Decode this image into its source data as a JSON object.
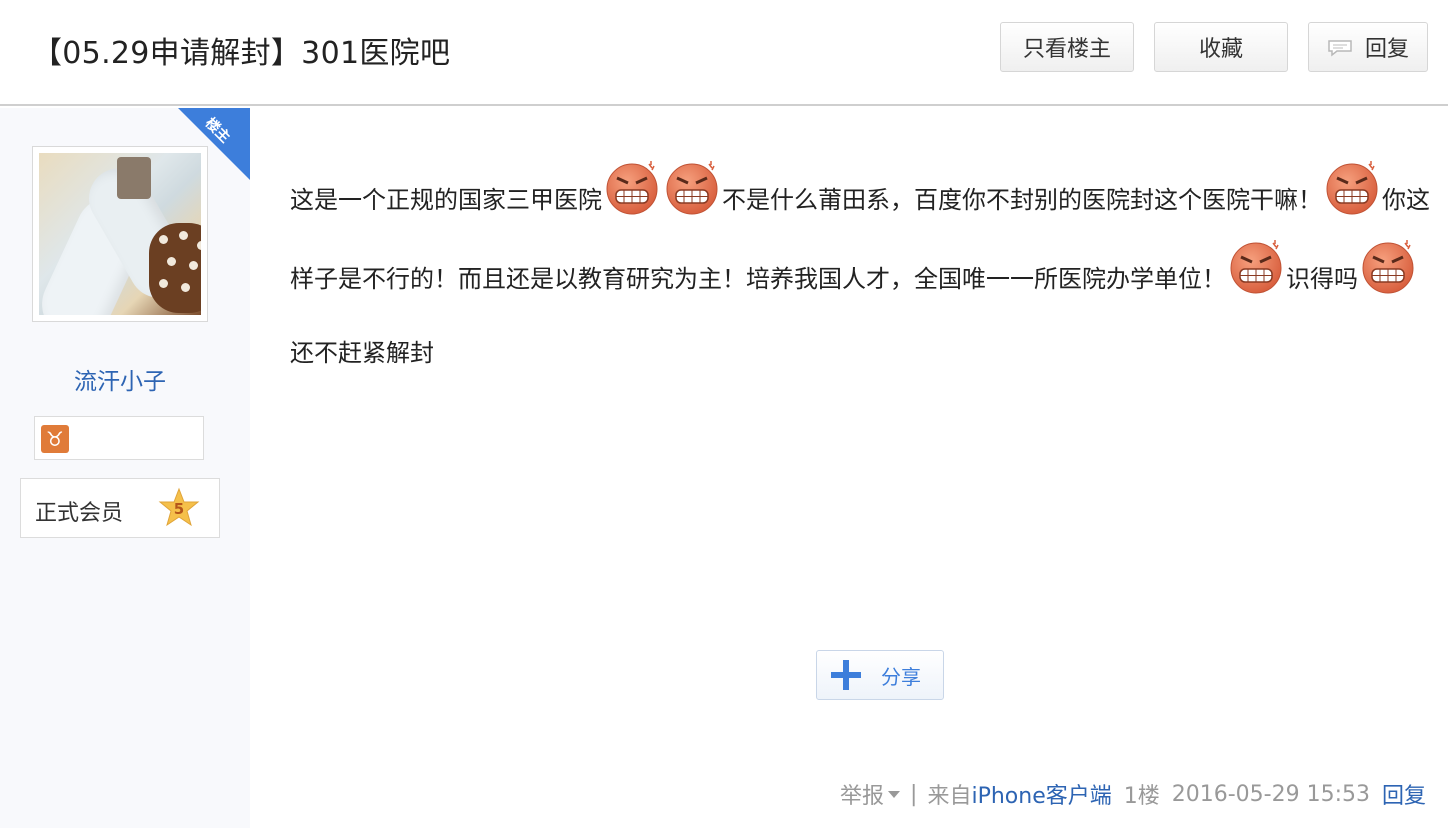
{
  "header": {
    "title": "【05.29申请解封】301医院吧",
    "only_owner_label": "只看楼主",
    "favorite_label": "收藏",
    "reply_label": "回复"
  },
  "sidebar": {
    "owner_badge": "楼主",
    "username": "流汗小子",
    "member_level_label": "正式会员",
    "member_level": "5",
    "zodiac_icon": "taurus-icon"
  },
  "post": {
    "segments": [
      "这是一个正规的国家三甲医院",
      "不是什么莆田系，百度你不封别的医院封这个医院干嘛！",
      "你这样子是不行的！而且还是以教育研究为主！培养我国人才，全国唯一一所医院办学单位！",
      "识得吗",
      "还不赶紧解封"
    ],
    "emoticon": "angry-grin-emoticon"
  },
  "share": {
    "label": "分享"
  },
  "footer": {
    "report": "举报",
    "divider": "|",
    "source_prefix": "来自",
    "source_client": "iPhone客户端",
    "floor": "1楼",
    "datetime": "2016-05-29 15:53",
    "reply": "回复"
  },
  "colors": {
    "link_blue": "#2d64b3",
    "accent_blue": "#3d7edb",
    "sidebar_bg": "#f8f9fc",
    "muted_text": "#999999"
  }
}
